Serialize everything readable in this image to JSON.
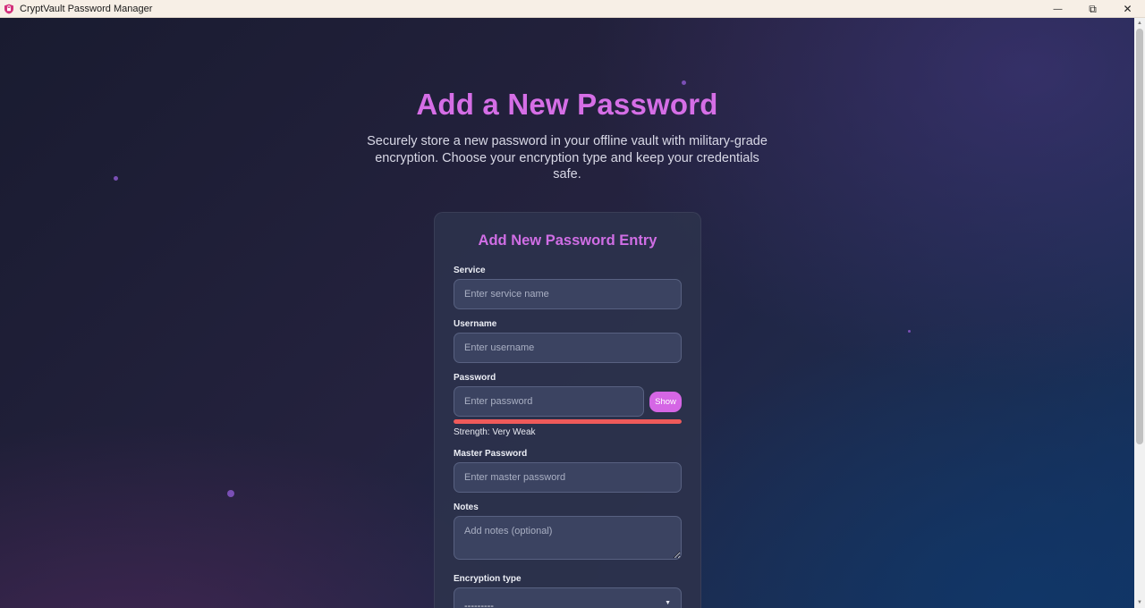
{
  "window": {
    "title": "CryptVault Password Manager",
    "minimize_glyph": "—",
    "maximize_glyph": "⧉",
    "close_glyph": "✕"
  },
  "hero": {
    "title": "Add a New Password",
    "subtitle": "Securely store a new password in your offline vault with military-grade encryption. Choose your encryption type and keep your credentials safe."
  },
  "form": {
    "title": "Add New Password Entry",
    "service": {
      "label": "Service",
      "placeholder": "Enter service name"
    },
    "username": {
      "label": "Username",
      "placeholder": "Enter username"
    },
    "password": {
      "label": "Password",
      "placeholder": "Enter password",
      "show_label": "Show"
    },
    "strength": {
      "text": "Strength: Very Weak",
      "level": 1.0,
      "color": "#ef5a5a"
    },
    "master_password": {
      "label": "Master Password",
      "placeholder": "Enter master password"
    },
    "notes": {
      "label": "Notes",
      "placeholder": "Add notes (optional)"
    },
    "encryption": {
      "label": "Encryption type",
      "selected": "---------"
    }
  },
  "colors": {
    "accent": "#d56ee6",
    "button": "#d566e5",
    "strength_weak": "#ef5a5a"
  }
}
